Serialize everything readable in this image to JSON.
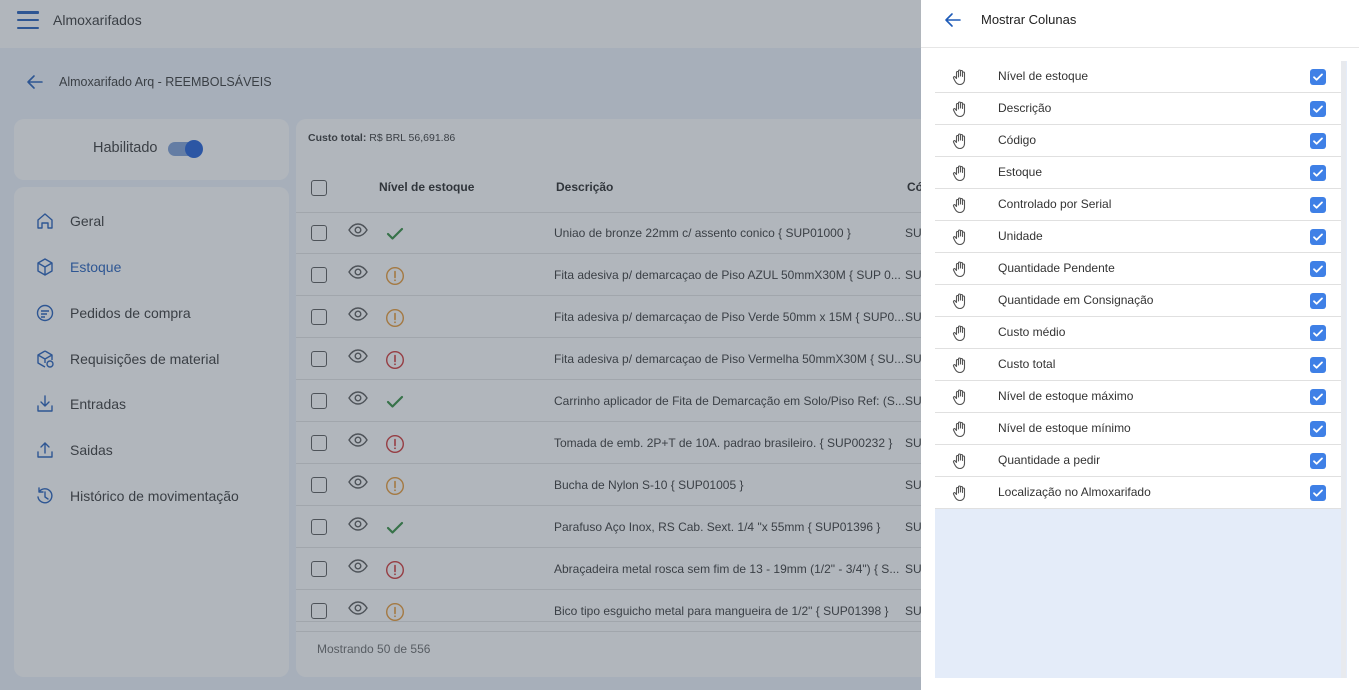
{
  "app": {
    "title": "Almoxarifados",
    "breadcrumb": "Almoxarifado Arq - REEMBOLSÁVEIS",
    "enabled_label": "Habilitado",
    "enabled": true
  },
  "nav": [
    {
      "label": "Geral",
      "icon": "home-icon",
      "active": false
    },
    {
      "label": "Estoque",
      "icon": "box-icon",
      "active": true
    },
    {
      "label": "Pedidos de compra",
      "icon": "purchase-order-icon",
      "active": false
    },
    {
      "label": "Requisições de material",
      "icon": "requisition-icon",
      "active": false
    },
    {
      "label": "Entradas",
      "icon": "download-icon",
      "active": false
    },
    {
      "label": "Saidas",
      "icon": "upload-icon",
      "active": false
    },
    {
      "label": "Histórico de movimentação",
      "icon": "history-icon",
      "active": false
    }
  ],
  "table": {
    "total_cost_label": "Custo total:",
    "total_cost_value": "R$ BRL 56,691.86",
    "headers": {
      "stock_level": "Nível de estoque",
      "description": "Descrição",
      "code": "Có"
    },
    "rows": [
      {
        "description": "Uniao de bronze 22mm c/ assento conico { SUP01000 }",
        "code": "SU",
        "status": "ok"
      },
      {
        "description": "Fita adesiva p/ demarcaçao de Piso AZUL 50mmX30M { SUP 0...",
        "code": "SU",
        "status": "warning"
      },
      {
        "description": "Fita adesiva p/ demarcaçao de Piso Verde 50mm x 15M { SUP0...",
        "code": "SU",
        "status": "warning"
      },
      {
        "description": "Fita adesiva p/ demarcaçao de Piso Vermelha 50mmX30M { SU...",
        "code": "SU",
        "status": "critical"
      },
      {
        "description": "Carrinho aplicador de Fita de Demarcação em Solo/Piso Ref: (S...",
        "code": "SU",
        "status": "ok"
      },
      {
        "description": "Tomada de emb. 2P+T de 10A. padrao brasileiro. { SUP00232 }",
        "code": "SU",
        "status": "critical"
      },
      {
        "description": "Bucha de Nylon S-10 { SUP01005 }",
        "code": "SU",
        "status": "warning"
      },
      {
        "description": "Parafuso Aço Inox, RS Cab. Sext. 1/4 \"x 55mm { SUP01396 }",
        "code": "SU",
        "status": "ok"
      },
      {
        "description": "Abraçadeira metal rosca sem fim de 13 - 19mm (1/2\" - 3/4\") { S...",
        "code": "SU",
        "status": "critical"
      },
      {
        "description": "Bico tipo esguicho metal para mangueira de 1/2\" { SUP01398 }",
        "code": "SU",
        "status": "warning"
      }
    ],
    "footer": "Mostrando 50 de 556"
  },
  "panel": {
    "title": "Mostrar Colunas",
    "columns": [
      {
        "label": "Nível de estoque",
        "checked": true
      },
      {
        "label": "Descrição",
        "checked": true
      },
      {
        "label": "Código",
        "checked": true
      },
      {
        "label": "Estoque",
        "checked": true
      },
      {
        "label": "Controlado por Serial",
        "checked": true
      },
      {
        "label": "Unidade",
        "checked": true
      },
      {
        "label": "Quantidade Pendente",
        "checked": true
      },
      {
        "label": "Quantidade em Consignação",
        "checked": true
      },
      {
        "label": "Custo médio",
        "checked": true
      },
      {
        "label": "Custo total",
        "checked": true
      },
      {
        "label": "Nível de estoque máximo",
        "checked": true
      },
      {
        "label": "Nível de estoque mínimo",
        "checked": true
      },
      {
        "label": "Quantidade a pedir",
        "checked": true
      },
      {
        "label": "Localização no Almoxarifado",
        "checked": true
      }
    ]
  },
  "colors": {
    "accent": "#1e5bb8",
    "checkbox": "#3f80e6",
    "ok": "#2e8b3a",
    "warning": "#e8962e",
    "critical": "#d03030",
    "list_bg": "#e4ecf9"
  }
}
